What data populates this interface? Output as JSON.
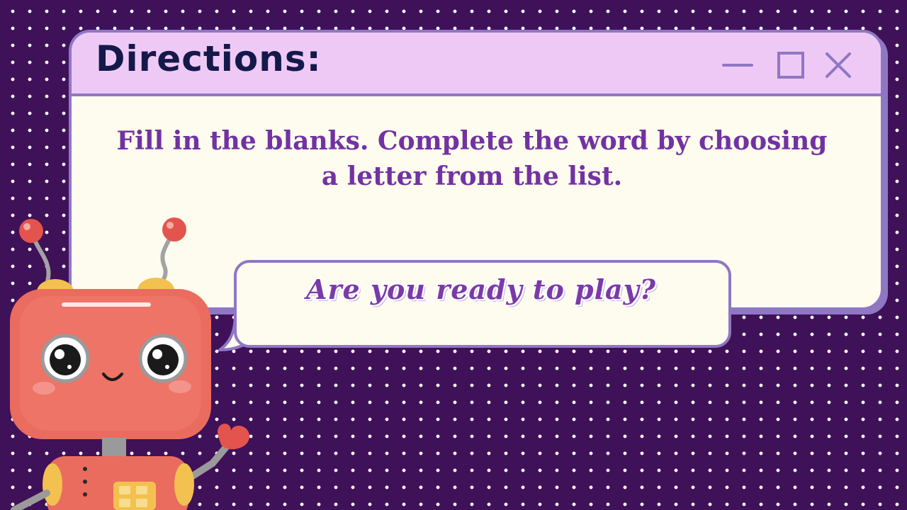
{
  "window": {
    "title": "Directions:",
    "controls": {
      "minimize_icon": "minimize-icon",
      "maximize_icon": "maximize-icon",
      "close_icon": "close-icon"
    },
    "body_text": "Fill in the blanks. Complete the word by choosing a letter from the list."
  },
  "bubble": {
    "text": "Are you ready to play?"
  },
  "illustration": {
    "name": "robot-mascot"
  },
  "colors": {
    "background": "#3f1158",
    "titlebar": "#efc9f5",
    "border": "#8f77c4",
    "panel": "#fefcee",
    "title_text": "#14194a",
    "body_text": "#7232a2"
  }
}
